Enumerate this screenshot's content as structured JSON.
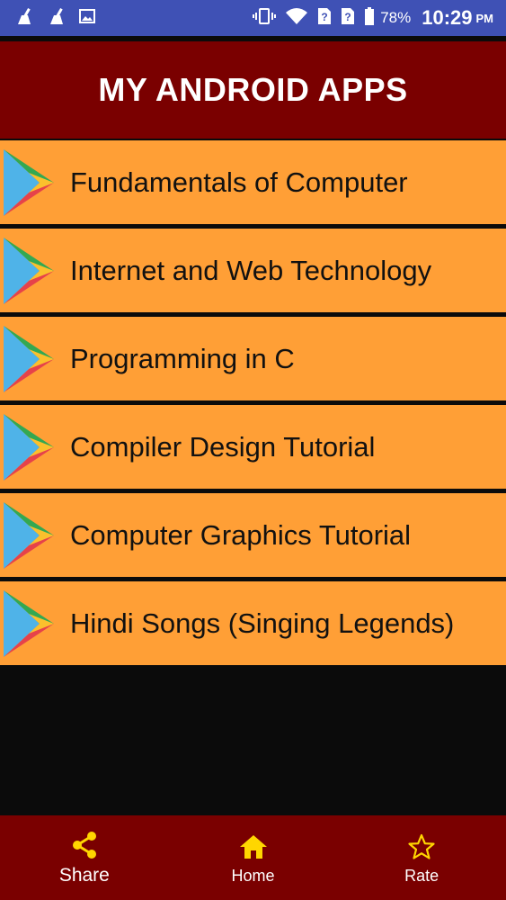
{
  "status_bar": {
    "left_icons": [
      "cleaner-icon",
      "cleaner-icon",
      "image-icon"
    ],
    "right_icons": [
      "vibrate-icon",
      "wifi-icon",
      "sim-unknown-icon",
      "sim-unknown-icon",
      "battery-icon"
    ],
    "battery_percent": "78%",
    "time": "10:29",
    "time_suffix": "PM",
    "background": "#3f51b5"
  },
  "header": {
    "title": "MY ANDROID APPS",
    "background": "#7a0000"
  },
  "apps": [
    {
      "name": "Fundamentals of Computer",
      "icon": "play-store-icon"
    },
    {
      "name": "Internet and Web Technology",
      "icon": "play-store-icon"
    },
    {
      "name": "Programming in C",
      "icon": "play-store-icon"
    },
    {
      "name": "Compiler Design Tutorial",
      "icon": "play-store-icon"
    },
    {
      "name": "Computer Graphics Tutorial",
      "icon": "play-store-icon"
    },
    {
      "name": "Hindi Songs (Singing Legends)",
      "icon": "play-store-icon"
    }
  ],
  "list_item_color": "#ff9f36",
  "bottom_nav": {
    "background": "#7a0000",
    "icon_color": "#ffd600",
    "items": [
      {
        "label": "Share",
        "icon": "share-icon"
      },
      {
        "label": "Home",
        "icon": "home-icon"
      },
      {
        "label": "Rate",
        "icon": "star-icon"
      }
    ]
  }
}
